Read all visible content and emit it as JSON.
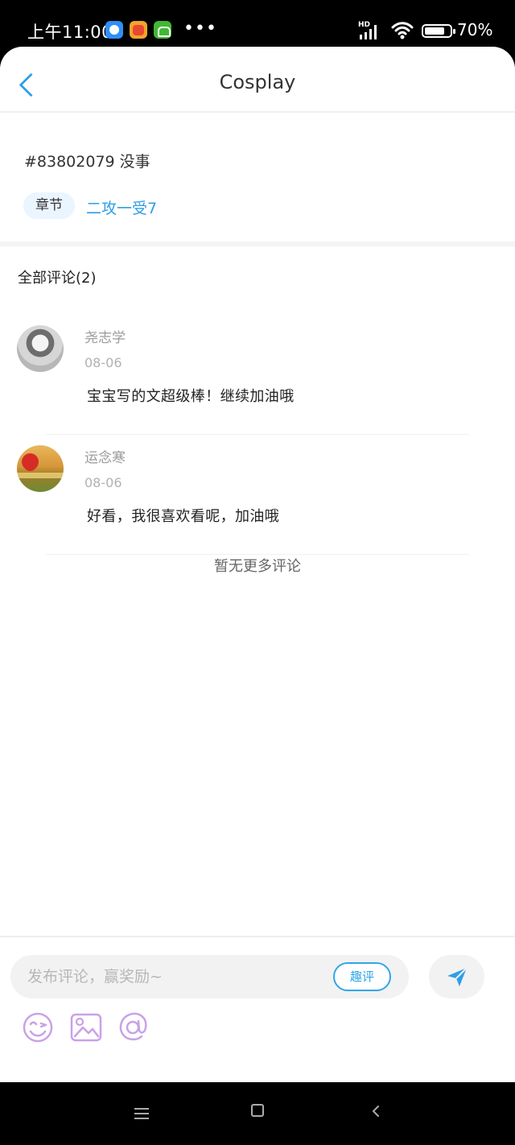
{
  "status_bar": {
    "time": "上午11:00",
    "more": "•••",
    "hd": "HD",
    "battery": "70%"
  },
  "header": {
    "title": "Cosplay"
  },
  "post": {
    "title": "#83802079 没事",
    "tag": "章节",
    "chapter": "二攻一受7"
  },
  "comments_section": {
    "title": "全部评论(2)",
    "empty_text": "暂无更多评论",
    "items": [
      {
        "user": "尧志学",
        "date": "08-06",
        "text": "宝宝写的文超级棒！继续加油哦"
      },
      {
        "user": "运念寒",
        "date": "08-06",
        "text": "好看，我很喜欢看呢，加油哦"
      }
    ]
  },
  "composer": {
    "placeholder": "发布评论，赢奖励~",
    "quick_review": "趣评"
  },
  "icons": {
    "back": "back-icon",
    "send": "paper-plane-icon",
    "emoji": "smiley-icon",
    "image": "image-icon",
    "mention": "at-icon"
  },
  "colors": {
    "accent": "#2f9ee8",
    "composer_icons": "#c8a2e8"
  }
}
